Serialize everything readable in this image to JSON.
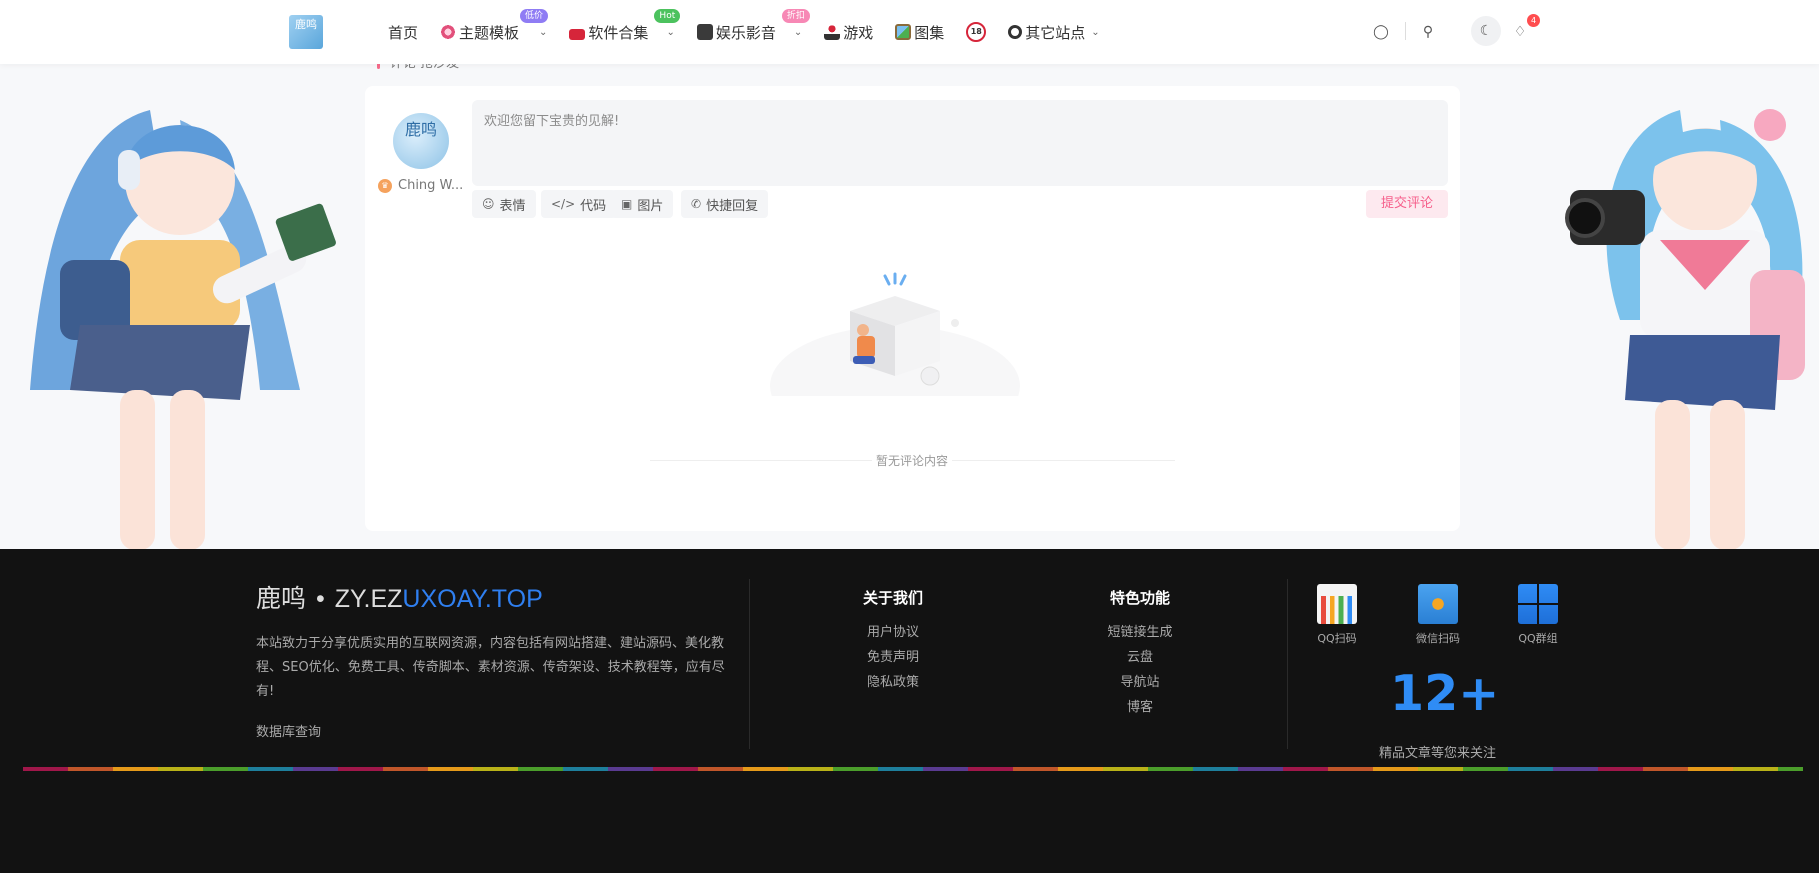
{
  "header": {
    "logo_text": "鹿鸣",
    "nav": [
      {
        "label": "首页"
      },
      {
        "label": "主题模板",
        "badge": "低价",
        "badge_color": "#8f7cf4",
        "has_caret": true
      },
      {
        "label": "软件合集",
        "badge": "Hot",
        "badge_color": "#4cc25e",
        "has_caret": true
      },
      {
        "label": "娱乐影音",
        "badge": "折扣",
        "badge_color": "#f788b5",
        "has_caret": true
      },
      {
        "label": "游戏"
      },
      {
        "label": "图集"
      },
      {
        "label": "18"
      },
      {
        "label": "其它站点",
        "has_caret": true
      }
    ],
    "notification_count": "4"
  },
  "comments": {
    "section_title": "评论 抢沙发",
    "avatar_text": "鹿鸣",
    "username": "Ching W...",
    "placeholder": "欢迎您留下宝贵的见解!",
    "tools": {
      "emoji": "表情",
      "code": "代码",
      "image": "图片",
      "quick_reply": "快捷回复"
    },
    "submit": "提交评论",
    "empty_text": "暂无评论内容"
  },
  "footer": {
    "brand_left": "鹿鸣",
    "brand_sep": "•",
    "brand_plain": "ZY.EZ",
    "brand_highlight": "UXOAY.TOP",
    "description": "本站致力于分享优质实用的互联网资源，内容包括有网站搭建、建站源码、美化教程、SEO优化、免费工具、传奇脚本、素材资源、传奇架设、技术教程等，应有尽有!",
    "db_query": "数据库查询",
    "about": {
      "heading": "关于我们",
      "links": [
        "用户协议",
        "免责声明",
        "隐私政策"
      ]
    },
    "features": {
      "heading": "特色功能",
      "links": [
        "短链接生成",
        "云盘",
        "导航站",
        "博客"
      ]
    },
    "qr": [
      {
        "label": "QQ扫码"
      },
      {
        "label": "微信扫码"
      },
      {
        "label": "QQ群组"
      }
    ],
    "big_number": "12+",
    "follow_text": "精品文章等您来关注"
  },
  "colors": {
    "accent_pink": "#f65f8b",
    "accent_blue": "#2f8cf5",
    "footer_bg": "#121212"
  }
}
